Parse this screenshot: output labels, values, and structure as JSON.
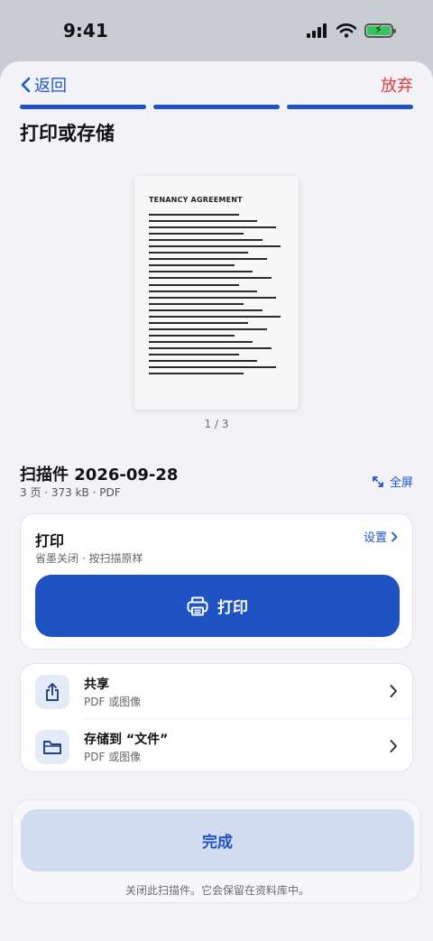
{
  "status_bar": {
    "time": "9:41"
  },
  "nav": {
    "back_label": "返回",
    "discard_label": "放弃"
  },
  "progress_steps": 3,
  "title": "打印或存储",
  "preview": {
    "doc_title": "TENANCY AGREEMENT",
    "page_counter": "1 / 3"
  },
  "file": {
    "name": "扫描件 2026-09-28",
    "meta": "3 页 · 373 kB · PDF",
    "fullscreen_label": "全屏"
  },
  "print_card": {
    "title": "打印",
    "subtitle": "省墨关闭 · 按扫描原样",
    "settings_label": "设置",
    "button_label": "打印"
  },
  "actions": [
    {
      "label": "共享",
      "sub": "PDF 或图像",
      "icon": "share-icon"
    },
    {
      "label": "存储到 “文件”",
      "sub": "PDF 或图像",
      "icon": "folder-icon"
    }
  ],
  "done": {
    "button_label": "完成",
    "note": "关闭此扫描件。它会保留在资料库中。"
  },
  "colors": {
    "accent": "#1f52c3",
    "discard": "#e03a3a",
    "background": "#f2f2f7"
  }
}
